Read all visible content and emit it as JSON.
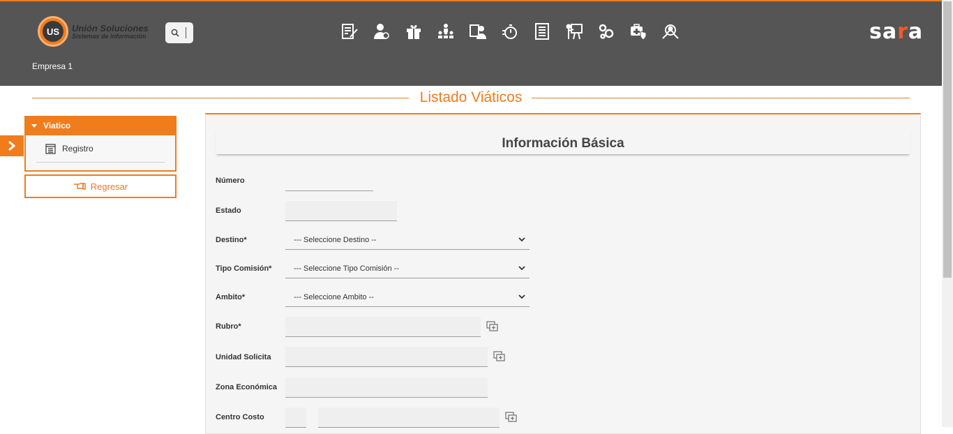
{
  "header": {
    "logo_line1": "Unión Soluciones",
    "logo_line2": "Sistemas de Información",
    "logo_badge": "US",
    "brand": "sara",
    "company": "Empresa 1",
    "modules": [
      "document-edit-icon",
      "user-money-icon",
      "gift-icon",
      "org-chart-icon",
      "id-card-user-icon",
      "stopwatch-icon",
      "report-sheet-icon",
      "presentation-icon",
      "gears-icon",
      "health-shield-icon",
      "search-people-icon"
    ]
  },
  "page": {
    "title": "Listado Viáticos"
  },
  "sidebar": {
    "group_label": "Viatico",
    "items": [
      {
        "label": "Registro"
      }
    ],
    "back_label": "Regresar"
  },
  "form": {
    "section_title": "Información Básica",
    "fields": {
      "numero": {
        "label": "Número",
        "value": ""
      },
      "estado": {
        "label": "Estado",
        "value": ""
      },
      "destino": {
        "label": "Destino*",
        "selected": "--- Seleccione Destino --"
      },
      "tipo_comision": {
        "label": "Tipo Comisión*",
        "selected": "--- Seleccione Tipo Comisión --"
      },
      "ambito": {
        "label": "Ambito*",
        "selected": "--- Seleccione Ambito --"
      },
      "rubro": {
        "label": "Rubro*",
        "value": ""
      },
      "unidad_solicita": {
        "label": "Unidad Solicita",
        "value": ""
      },
      "zona_economica": {
        "label": "Zona Económica",
        "value": ""
      },
      "centro_costo": {
        "label": "Centro Costo",
        "value": ""
      }
    }
  },
  "colors": {
    "accent": "#f07c1c",
    "header_bg": "#555555",
    "form_bg": "#f5f5f5"
  }
}
